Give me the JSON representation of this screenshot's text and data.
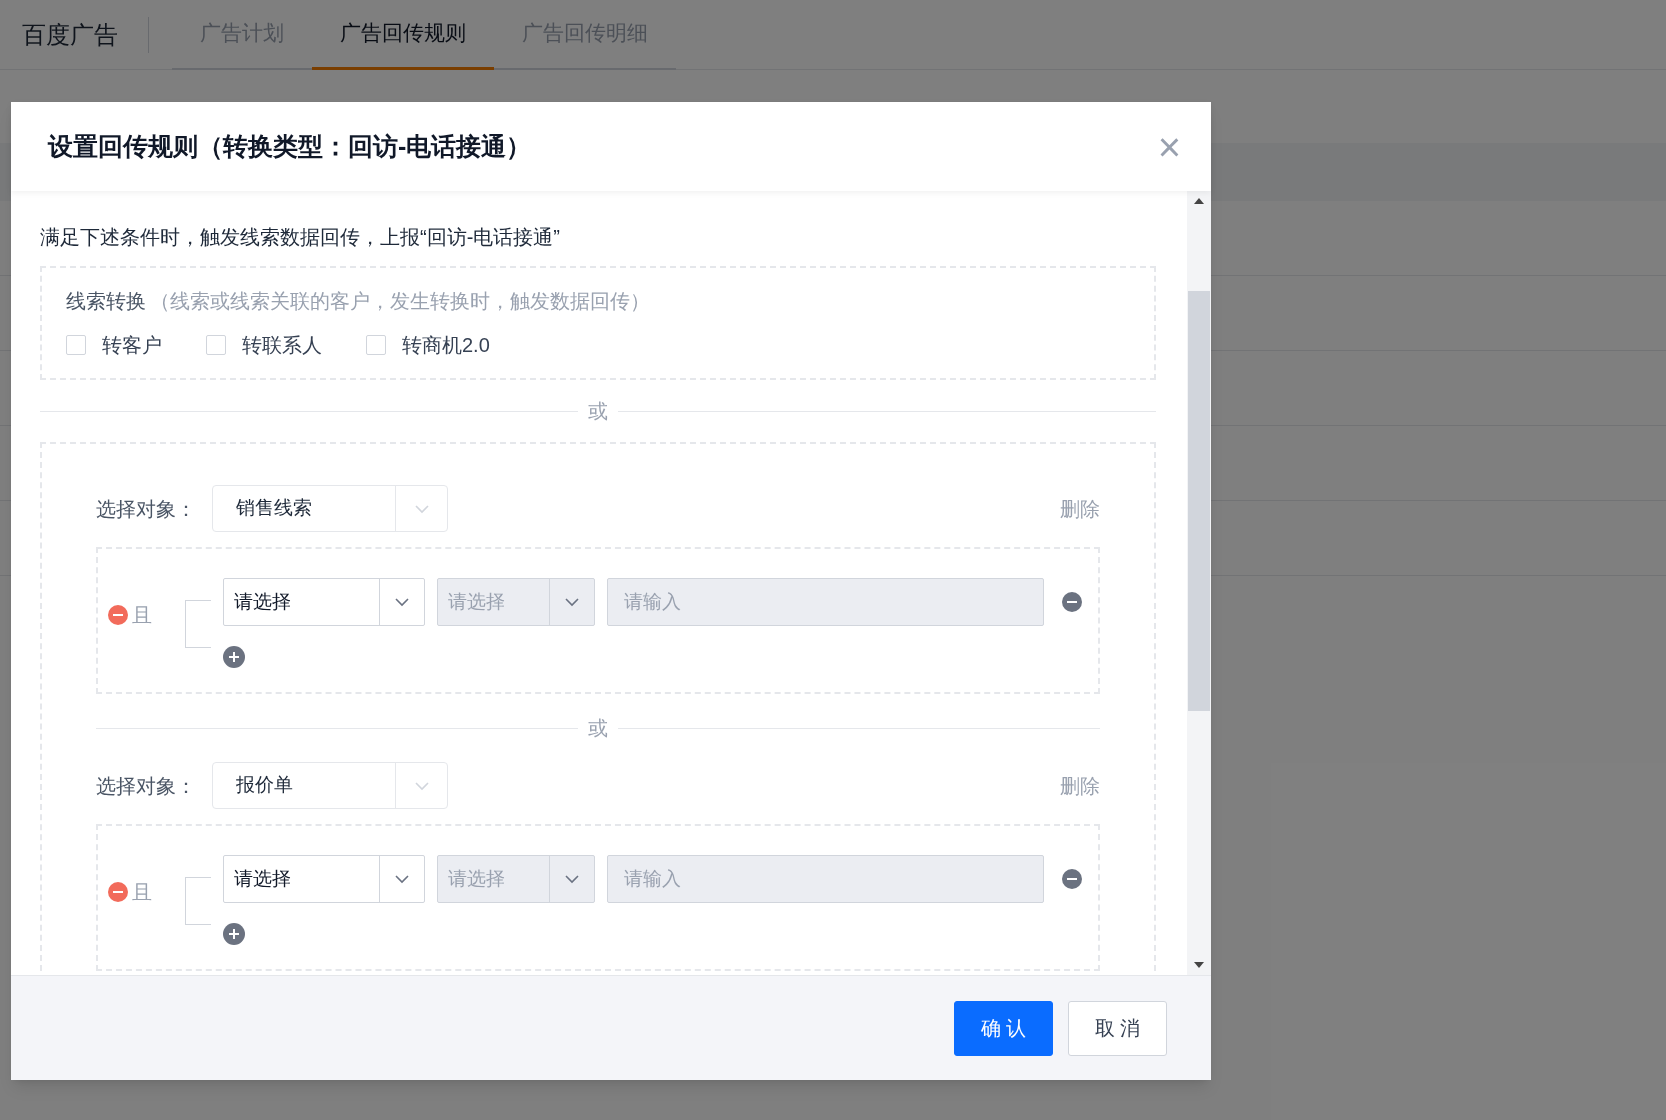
{
  "app": {
    "brand": "百度广告",
    "tabs": [
      {
        "label": "广告计划",
        "selected": false
      },
      {
        "label": "广告回传规则",
        "selected": true
      },
      {
        "label": "广告回传明细",
        "selected": false
      }
    ]
  },
  "dialog": {
    "title": "设置回传规则（转换类型：回访-电话接通）",
    "close": "×",
    "intro": "满足下述条件时，触发线索数据回传，上报“回访-电话接通”",
    "lead_conversion": {
      "label": "线索转换",
      "hint": "（线索或线索关联的客户，发生转换时，触发数据回传）",
      "options": [
        {
          "label": "转客户",
          "checked": false
        },
        {
          "label": "转联系人",
          "checked": false
        },
        {
          "label": "转商机2.0",
          "checked": false
        }
      ]
    },
    "or_label": "或",
    "groups": [
      {
        "object_label": "选择对象：",
        "object": "销售线索",
        "delete": "删除",
        "conditions": [
          {
            "logic": "且",
            "field": {
              "value": "请选择",
              "disabled": false
            },
            "operator": {
              "placeholder": "请选择",
              "disabled": true
            },
            "value": {
              "placeholder": "请输入",
              "disabled": true
            }
          }
        ]
      },
      {
        "separator": "或",
        "object_label": "选择对象：",
        "object": "报价单",
        "delete": "删除",
        "conditions": [
          {
            "logic": "且",
            "field": {
              "value": "请选择",
              "disabled": false
            },
            "operator": {
              "placeholder": "请选择",
              "disabled": true
            },
            "value": {
              "placeholder": "请输入",
              "disabled": true
            }
          }
        ]
      }
    ],
    "buttons": [
      {
        "kind": "primary",
        "label": "确 认"
      },
      {
        "kind": "secondary",
        "label": "取 消"
      }
    ]
  }
}
